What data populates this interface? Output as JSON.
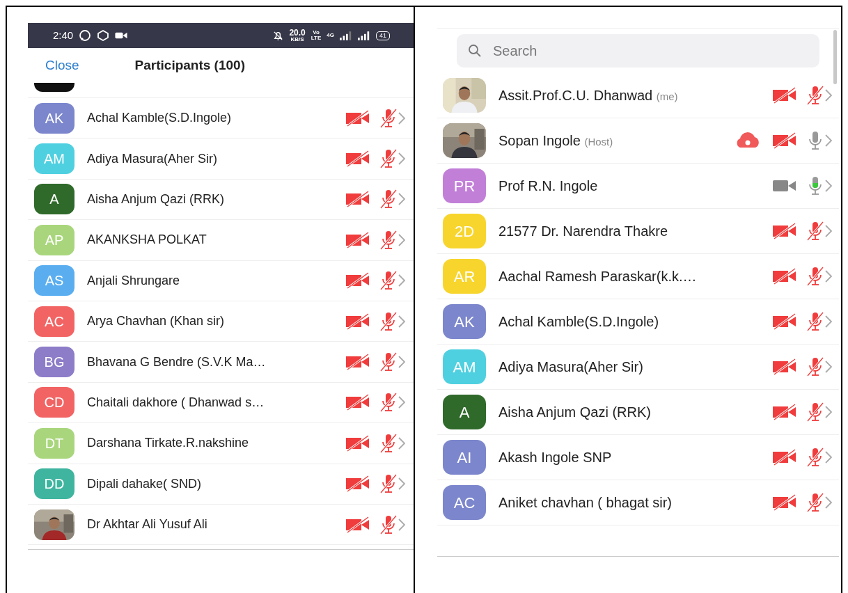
{
  "left_panel": {
    "status_bar": {
      "time": "2:40",
      "speed": "20.0",
      "speed_unit": "KB/S",
      "volte_top": "Vo",
      "volte_bottom": "LTE",
      "network": "4G",
      "battery": "41"
    },
    "header": {
      "close": "Close",
      "title": "Participants (100)"
    },
    "participants": [
      {
        "kind": "initials",
        "initials": "AK",
        "color": "#7b86cc",
        "name": "Achal Kamble(S.D.Ingole)",
        "camera_on": false,
        "mic_on": false
      },
      {
        "kind": "initials",
        "initials": "AM",
        "color": "#4fd0e0",
        "name": "Adiya Masura(Aher Sir)",
        "camera_on": false,
        "mic_on": false
      },
      {
        "kind": "initials",
        "initials": "A",
        "color": "#2f6a2a",
        "name": "Aisha Anjum Qazi (RRK)",
        "camera_on": false,
        "mic_on": false
      },
      {
        "kind": "initials",
        "initials": "AP",
        "color": "#a9d67c",
        "name": "AKANKSHA POLKAT",
        "camera_on": false,
        "mic_on": false
      },
      {
        "kind": "initials",
        "initials": "AS",
        "color": "#5aaef0",
        "name": "Anjali Shrungare",
        "camera_on": false,
        "mic_on": false
      },
      {
        "kind": "initials",
        "initials": "AC",
        "color": "#f26464",
        "name": "Arya Chavhan (Khan sir)",
        "camera_on": false,
        "mic_on": false
      },
      {
        "kind": "initials",
        "initials": "BG",
        "color": "#8d7cc8",
        "name": "Bhavana G Bendre (S.V.K Ma…",
        "camera_on": false,
        "mic_on": false
      },
      {
        "kind": "initials",
        "initials": "CD",
        "color": "#f26464",
        "name": "Chaitali dakhore ( Dhanwad s…",
        "camera_on": false,
        "mic_on": false
      },
      {
        "kind": "initials",
        "initials": "DT",
        "color": "#a9d67c",
        "name": "Darshana Tirkate.R.nakshine",
        "camera_on": false,
        "mic_on": false
      },
      {
        "kind": "initials",
        "initials": "DD",
        "color": "#3fb5a0",
        "name": "Dipali dahake( SND)",
        "camera_on": false,
        "mic_on": false
      },
      {
        "name": "Dr Akhtar Ali Yusuf Ali",
        "camera_on": false,
        "mic_on": false
      }
    ]
  },
  "right_panel": {
    "search": {
      "placeholder": "Search"
    },
    "participants": [
      {
        "name": "Assit.Prof.C.U. Dhanwad",
        "tag": "(me)",
        "recording": false,
        "camera_on": false,
        "mic_on": false,
        "speaking": false
      },
      {
        "name": "Sopan Ingole",
        "tag": "(Host)",
        "recording": true,
        "camera_on": false,
        "mic_on": true,
        "speaking": false
      },
      {
        "kind": "initials",
        "initials": "PR",
        "color": "#c27fd8",
        "name": "Prof R.N. Ingole",
        "recording": false,
        "camera_on": true,
        "mic_on": true,
        "speaking": true
      },
      {
        "kind": "initials",
        "initials": "2D",
        "color": "#f7d52c",
        "name": "21577 Dr. Narendra Thakre",
        "recording": false,
        "camera_on": false,
        "mic_on": false,
        "speaking": false
      },
      {
        "kind": "initials",
        "initials": "AR",
        "color": "#f7d52c",
        "name": "Aachal Ramesh Paraskar(k.k.…",
        "recording": false,
        "camera_on": false,
        "mic_on": false,
        "speaking": false
      },
      {
        "kind": "initials",
        "initials": "AK",
        "color": "#7b86cc",
        "name": "Achal Kamble(S.D.Ingole)",
        "recording": false,
        "camera_on": false,
        "mic_on": false,
        "speaking": false
      },
      {
        "kind": "initials",
        "initials": "AM",
        "color": "#4fd0e0",
        "name": "Adiya Masura(Aher Sir)",
        "recording": false,
        "camera_on": false,
        "mic_on": false,
        "speaking": false
      },
      {
        "kind": "initials",
        "initials": "A",
        "color": "#2f6a2a",
        "name": "Aisha Anjum Qazi (RRK)",
        "recording": false,
        "camera_on": false,
        "mic_on": false,
        "speaking": false
      },
      {
        "kind": "initials",
        "initials": "AI",
        "color": "#7b86cc",
        "name": "Akash Ingole SNP",
        "recording": false,
        "camera_on": false,
        "mic_on": false,
        "speaking": false
      },
      {
        "kind": "initials",
        "initials": "AC",
        "color": "#7b86cc",
        "name": "Aniket chavhan ( bhagat sir)",
        "recording": false,
        "camera_on": false,
        "mic_on": false,
        "speaking": false
      }
    ]
  }
}
